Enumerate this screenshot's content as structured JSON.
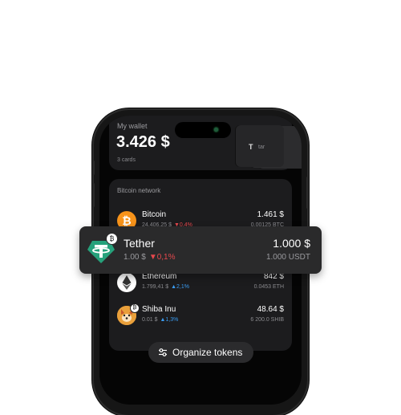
{
  "wallet": {
    "title": "My wallet",
    "amount": "3.426 $",
    "cards": "3 cards",
    "card_logo": "T",
    "card_text": "tar"
  },
  "network": {
    "title": "Bitcoin network",
    "tokens": [
      {
        "name": "Bitcoin",
        "price": "24.406,25 $",
        "change": "0,4%",
        "direction": "down",
        "value": "1.461 $",
        "amount": "0.00125 BTC",
        "icon": "bitcoin-icon"
      },
      {
        "name": "Ethereum",
        "price": "1.799,41 $",
        "change": "2,1%",
        "direction": "up",
        "value": "842 $",
        "amount": "0.0453 ETH",
        "icon": "ethereum-icon"
      },
      {
        "name": "Shiba Inu",
        "price": "0.01 $",
        "change": "1,3%",
        "direction": "up",
        "value": "48.64 $",
        "amount": "6 200.0 SHIB",
        "icon": "shiba-inu-icon"
      }
    ]
  },
  "tether": {
    "name": "Tether",
    "price": "1.00 $",
    "change": "0,1%",
    "direction": "down",
    "value": "1.000 $",
    "amount": "1.000 USDT",
    "icon": "tether-icon"
  },
  "organize_button": {
    "label": "Organize tokens",
    "icon": "sliders-icon"
  },
  "colors": {
    "up": "#3a9bf0",
    "down": "#e5484d",
    "tether": "#26a17b",
    "bitcoin": "#f7931a"
  }
}
